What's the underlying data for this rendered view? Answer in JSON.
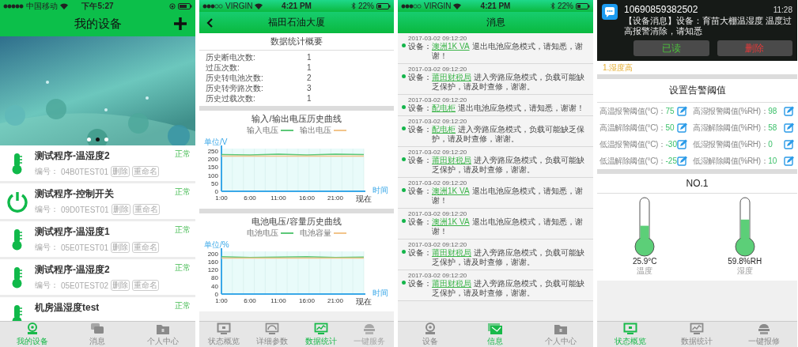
{
  "devices_screen": {
    "status_bar": {
      "carrier": "中国移动",
      "time": "下午5:27"
    },
    "header": {
      "title": "我的设备"
    },
    "banner_dots": [
      {
        "selected": false
      },
      {
        "selected": true
      },
      {
        "selected": false
      }
    ],
    "devices": [
      {
        "kind": "thermometer",
        "name": "测试程序-温湿度2",
        "code_label": "编号：",
        "code": "04B0TEST01",
        "actions": [
          "删除",
          "重命名"
        ],
        "status": "正常"
      },
      {
        "kind": "switch",
        "name": "测试程序-控制开关",
        "code_label": "编号：",
        "code": "09D0TEST01",
        "actions": [
          "删除",
          "重命名"
        ],
        "status": "正常"
      },
      {
        "kind": "thermometer",
        "name": "测试程序-温湿度1",
        "code_label": "编号：",
        "code": "05E0TEST01",
        "actions": [
          "删除",
          "重命名"
        ],
        "status": "正常"
      },
      {
        "kind": "thermometer",
        "name": "测试程序-温湿度2",
        "code_label": "编号：",
        "code": "05E0TEST02",
        "actions": [
          "删除",
          "重命名"
        ],
        "status": "正常"
      },
      {
        "kind": "thermometer",
        "name": "机房温湿度test",
        "status": "正常"
      }
    ],
    "tab_bar": [
      {
        "kind": "webcam",
        "label": "我的设备",
        "selected": true
      },
      {
        "kind": "chat",
        "label": "消息",
        "selected": false
      },
      {
        "kind": "folder",
        "label": "个人中心",
        "selected": false
      }
    ]
  },
  "stats_screen": {
    "status_bar": {
      "carrier": "VIRGIN",
      "time": "4:21 PM",
      "battery": "22%"
    },
    "header": {
      "title": "福田石油大厦"
    },
    "summary": {
      "title": "数据统计概要",
      "rows": [
        {
          "label": "历史断电次数:",
          "value": "1"
        },
        {
          "label": "过压次数:",
          "value": "1"
        },
        {
          "label": "历史转电池次数:",
          "value": "2"
        },
        {
          "label": "历史转旁路次数:",
          "value": "3"
        },
        {
          "label": "历史过载次数:",
          "value": "1"
        }
      ]
    },
    "charts": [
      {
        "chart_data": {
          "type": "line",
          "legend": true,
          "title": "输入/输出电压历史曲线",
          "ylabel": "单位/V",
          "xlabel": "时间",
          "categories": [
            "1:00",
            "6:00",
            "11:00",
            "16:00",
            "21:00",
            "现在"
          ],
          "ylim": [
            0,
            265
          ],
          "yticks": [
            0,
            50,
            100,
            150,
            200,
            250
          ],
          "series": [
            {
              "name": "输入电压",
              "color": "#5cc878",
              "values": [
                228,
                226,
                231,
                226,
                230,
                228
              ]
            },
            {
              "name": "输出电压",
              "color": "#f2c48a",
              "values": [
                219,
                219,
                219,
                219,
                219,
                219
              ]
            }
          ]
        }
      },
      {
        "chart_data": {
          "type": "line",
          "legend": true,
          "title": "电池电压/容量历史曲线",
          "ylabel": "单位/%",
          "xlabel": "时间",
          "categories": [
            "1:00",
            "6:00",
            "11:00",
            "16:00",
            "21:00",
            "现在"
          ],
          "ylim": [
            0,
            210
          ],
          "yticks": [
            0,
            40,
            80,
            120,
            160,
            200
          ],
          "series": [
            {
              "name": "电池电压",
              "color": "#5cc878",
              "values": [
                184,
                180,
                182,
                184,
                180,
                182
              ]
            },
            {
              "name": "电池容量",
              "color": "#f2c48a",
              "values": [
                177,
                177,
                177,
                177,
                177,
                177
              ]
            }
          ]
        }
      }
    ],
    "tab_bar": [
      {
        "kind": "monitor",
        "label": "状态概览",
        "selected": false,
        "disabled": false
      },
      {
        "kind": "gauge",
        "label": "详细参数",
        "selected": false,
        "disabled": false
      },
      {
        "kind": "chart",
        "label": "数据统计",
        "selected": true,
        "disabled": false
      },
      {
        "kind": "server",
        "label": "一键服务",
        "selected": false,
        "disabled": true
      }
    ]
  },
  "messages_screen": {
    "status_bar": {
      "carrier": "VIRGIN",
      "time": "4:21 PM",
      "battery": "22%"
    },
    "header": {
      "title": "消息"
    },
    "messages": [
      {
        "time": "2017-03-02 09:12:20",
        "prefix": "设备：",
        "device": "澳洲1K VA",
        "text": "退出电池应急模式，请知悉，谢谢！"
      },
      {
        "time": "2017-03-02 09:12:20",
        "prefix": "设备：",
        "device": "莆田财税局",
        "text": "进入旁路应急模式，负载可能缺乏保护，请及时查修，谢谢。"
      },
      {
        "time": "2017-03-02 09:12:20",
        "prefix": "设备：",
        "device": "配电柜",
        "text": "退出电池应急模式，请知悉，谢谢！"
      },
      {
        "time": "2017-03-02 09:12:20",
        "prefix": "设备：",
        "device": "配电柜",
        "text": "进入旁路应急模式，负载可能缺乏保护，请及时查修，谢谢。"
      },
      {
        "time": "2017-03-02 09:12:20",
        "prefix": "设备：",
        "device": "莆田财税局",
        "text": "进入旁路应急模式，负载可能缺乏保护，请及时查修，谢谢。"
      },
      {
        "time": "2017-03-02 09:12:20",
        "prefix": "设备：",
        "device": "澳洲1K VA",
        "text": "退出电池应急模式，请知悉，谢谢！"
      },
      {
        "time": "2017-03-02 09:12:20",
        "prefix": "设备：",
        "device": "澳洲1K VA",
        "text": "退出电池应急模式，请知悉，谢谢！"
      },
      {
        "time": "2017-03-02 09:12:20",
        "prefix": "设备：",
        "device": "莆田财税局",
        "text": "进入旁路应急模式，负载可能缺乏保护，请及时查修，谢谢。"
      },
      {
        "time": "2017-03-02 09:12:20",
        "prefix": "设备：",
        "device": "莆田财税局",
        "text": "进入旁路应急模式，负载可能缺乏保护，请及时查修，谢谢。"
      }
    ],
    "tab_bar": [
      {
        "kind": "webcam",
        "label": "设备",
        "selected": false
      },
      {
        "kind": "mail",
        "label": "信息",
        "selected": true
      },
      {
        "kind": "folder",
        "label": "个人中心",
        "selected": false
      }
    ]
  },
  "alarm_screen": {
    "notification": {
      "sender": "10690859382502",
      "time": "11:28",
      "text": "【设备消息】设备：育苗大棚温湿度 温度过高报警清除，请知悉",
      "buttons": [
        {
          "kind": "read",
          "label": "已读"
        },
        {
          "kind": "delete",
          "label": "删除"
        }
      ]
    },
    "alarms": [
      "1.湿度高"
    ],
    "thresholds": {
      "title": "设置告警阈值",
      "items": [
        {
          "label": "高温报警阈值(°C)：",
          "value": "75"
        },
        {
          "label": "高湿报警阈值(%RH)：",
          "value": "98"
        },
        {
          "label": "高温解除阈值(°C)：",
          "value": "50"
        },
        {
          "label": "高湿解除阈值(%RH)：",
          "value": "58"
        },
        {
          "label": "低温报警阈值(°C)：",
          "value": "-30"
        },
        {
          "label": "低湿报警阈值(%RH)：",
          "value": "0"
        },
        {
          "label": "低温解除阈值(°C)：",
          "value": "-25"
        },
        {
          "label": "低湿解除阈值(%RH)：",
          "value": "10"
        }
      ]
    },
    "device_title": "NO.1",
    "gauges": [
      {
        "value": "25.9°C",
        "label": "温度",
        "level": 0.45
      },
      {
        "value": "59.8%RH",
        "label": "湿度",
        "level": 0.6
      }
    ],
    "tab_bar": [
      {
        "kind": "monitor",
        "label": "状态概览",
        "selected": true
      },
      {
        "kind": "chart",
        "label": "数据统计",
        "selected": false
      },
      {
        "kind": "server",
        "label": "一键报修",
        "selected": false
      }
    ]
  }
}
